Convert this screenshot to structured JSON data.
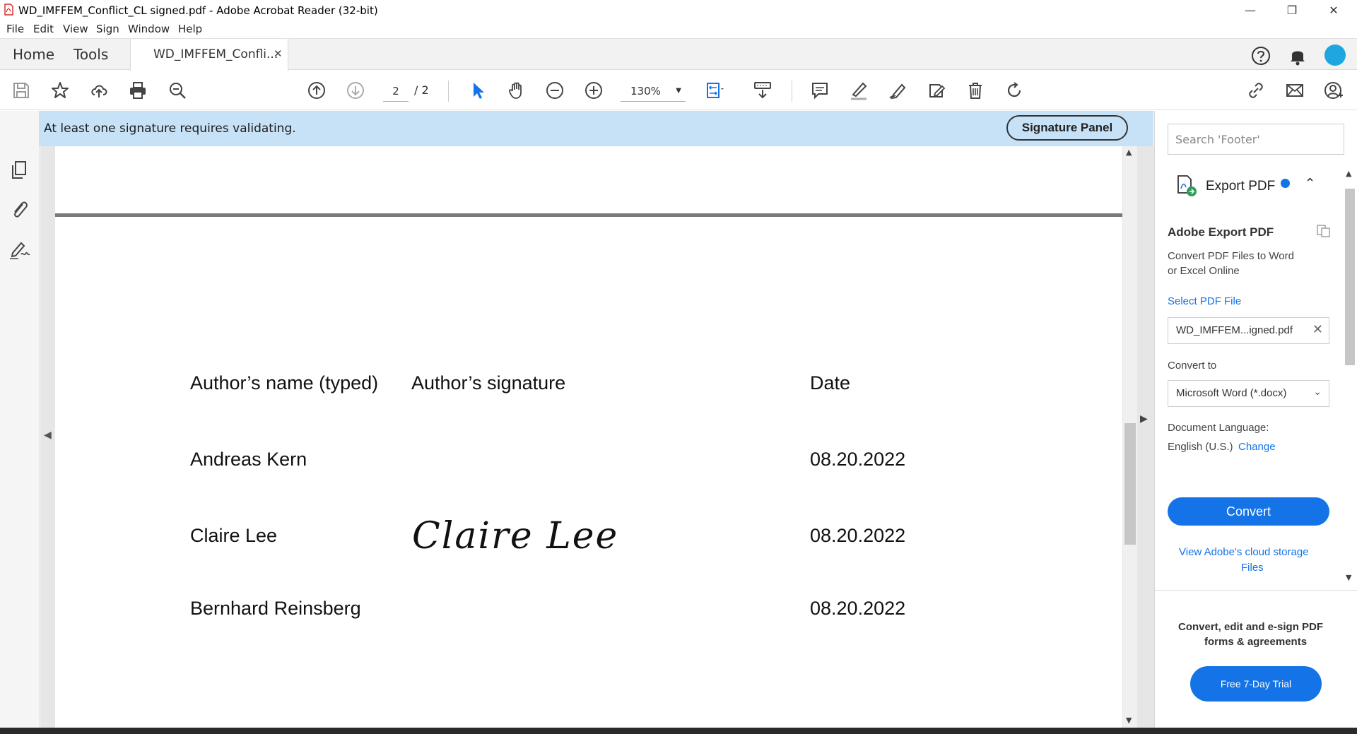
{
  "window": {
    "title": "WD_IMFFEM_Conflict_CL signed.pdf - Adobe Acrobat Reader (32-bit)",
    "minimize": "—",
    "maximize": "❐",
    "close": "✕"
  },
  "menu": {
    "file": "File",
    "edit": "Edit",
    "view": "View",
    "sign": "Sign",
    "window": "Window",
    "help": "Help"
  },
  "tabs": {
    "home": "Home",
    "tools": "Tools",
    "document": "WD_IMFFEM_Confli...",
    "close": "✕"
  },
  "toolbar": {
    "page_current": "2",
    "page_total": "/ 2",
    "zoom": "130%"
  },
  "notice": {
    "message": "At least one signature requires validating.",
    "button": "Signature Panel"
  },
  "document": {
    "headers": {
      "name": "Author’s name (typed)",
      "signature": "Author’s signature",
      "date": "Date"
    },
    "rows": [
      {
        "name": "Andreas Kern",
        "signature": "",
        "date": "08.20.2022"
      },
      {
        "name": "Claire Lee",
        "signature": "Claire Lee",
        "date": "08.20.2022"
      },
      {
        "name": "Bernhard Reinsberg",
        "signature": "",
        "date": "08.20.2022"
      }
    ]
  },
  "right_panel": {
    "search_placeholder": "Search 'Footer'",
    "tool_title": "Export PDF",
    "section_title": "Adobe Export PDF",
    "description_line1": "Convert PDF Files to Word",
    "description_line2": "or Excel Online",
    "select_file_link": "Select PDF File",
    "selected_file": "WD_IMFFEM...igned.pdf",
    "convert_to_label": "Convert to",
    "convert_to_value": "Microsoft Word (*.docx)",
    "doc_language_label": "Document Language:",
    "doc_language_value": "English (U.S.)",
    "change_link": "Change",
    "convert_button": "Convert",
    "cloud_link_line1": "View Adobe's cloud storage",
    "cloud_link_line2": "Files",
    "promo_line1": "Convert, edit and e-sign PDF",
    "promo_line2": "forms & agreements",
    "trial_button": "Free 7-Day Trial"
  },
  "colors": {
    "accent": "#1473e6",
    "notice_bg": "#c7e2f7",
    "avatar": "#1fa6e0"
  }
}
